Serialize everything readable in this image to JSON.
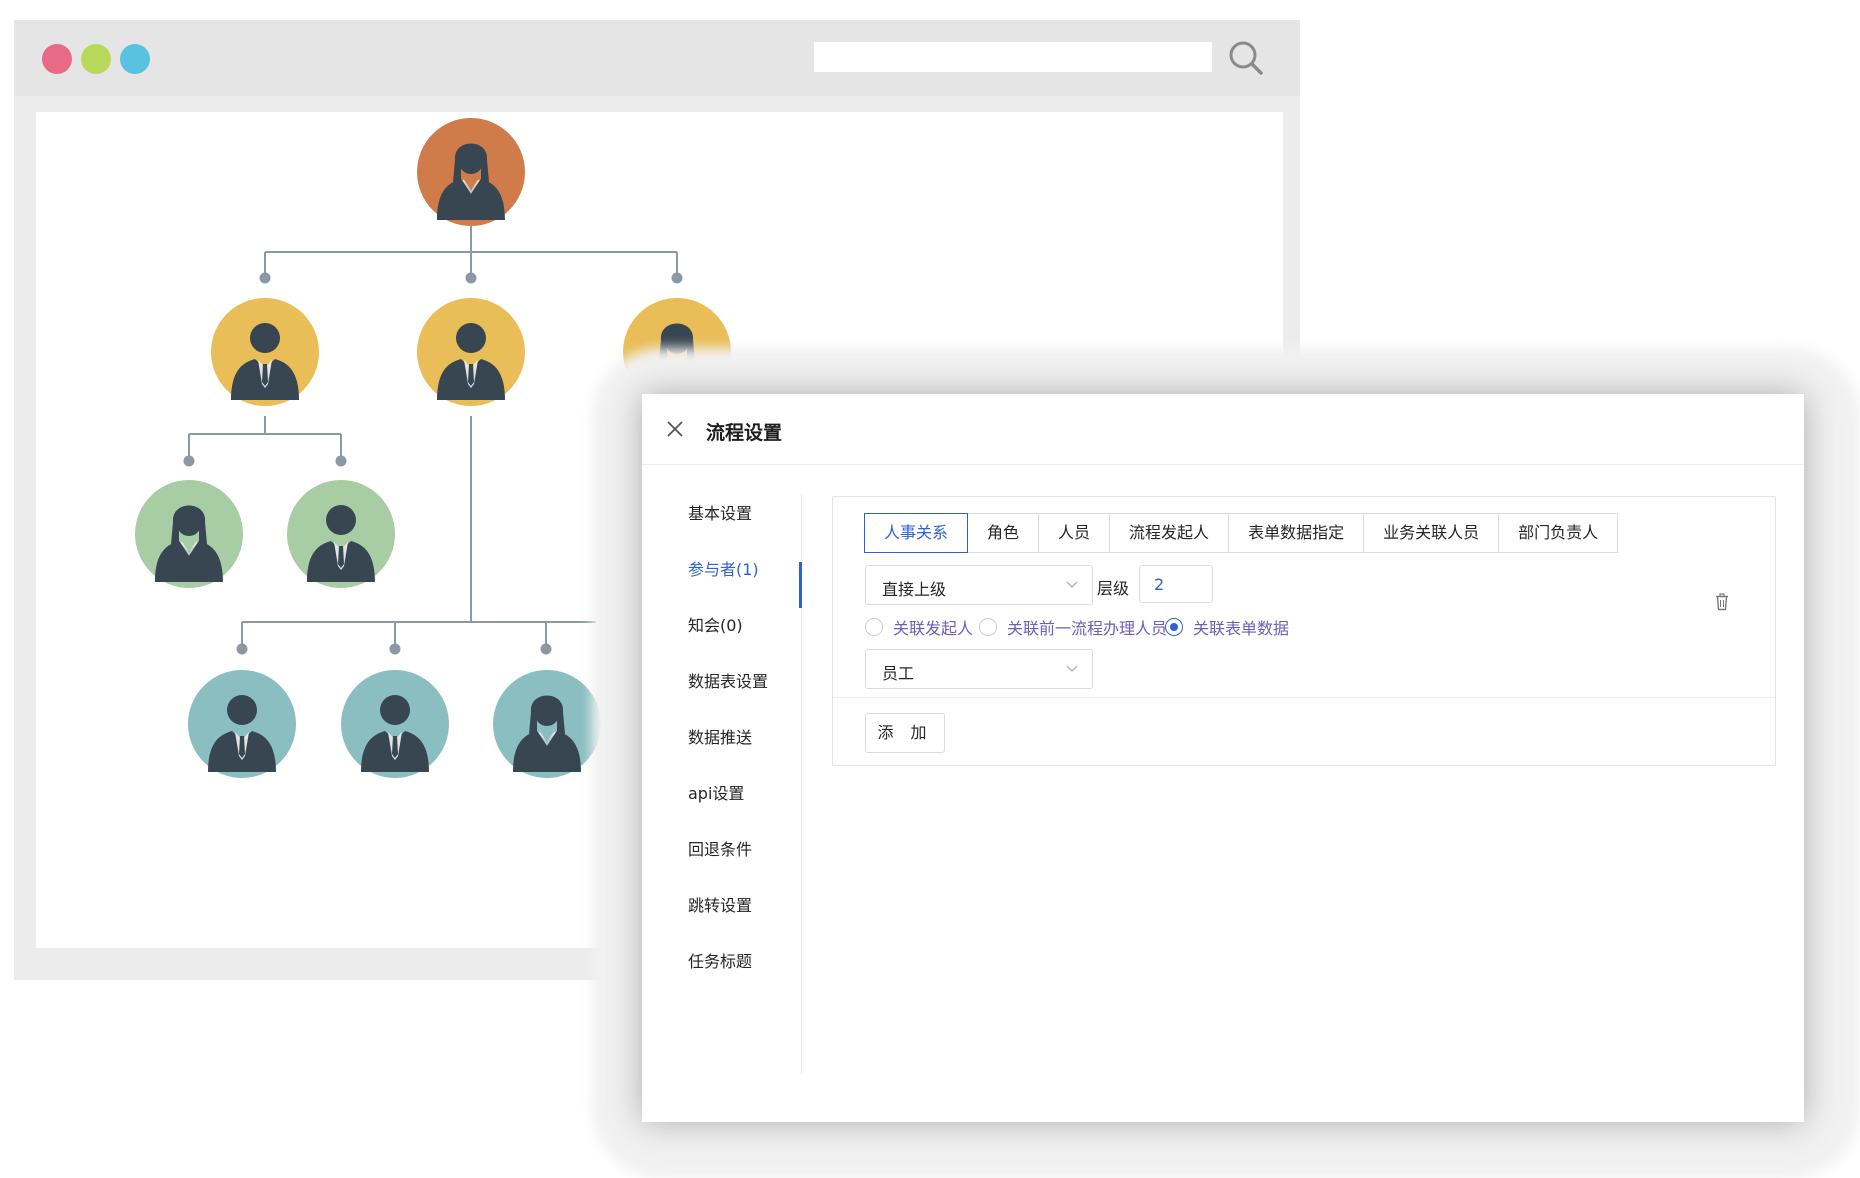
{
  "dialog": {
    "title": "流程设置"
  },
  "side_nav": {
    "items": [
      {
        "label": "基本设置"
      },
      {
        "label": "参与者(1)",
        "active": true
      },
      {
        "label": "知会(0)"
      },
      {
        "label": "数据表设置"
      },
      {
        "label": "数据推送"
      },
      {
        "label": "api设置"
      },
      {
        "label": "回退条件"
      },
      {
        "label": "跳转设置"
      },
      {
        "label": "任务标题"
      }
    ]
  },
  "tabs": [
    {
      "label": "人事关系",
      "active": true
    },
    {
      "label": "角色"
    },
    {
      "label": "人员"
    },
    {
      "label": "流程发起人"
    },
    {
      "label": "表单数据指定"
    },
    {
      "label": "业务关联人员"
    },
    {
      "label": "部门负责人"
    }
  ],
  "form": {
    "relation_select": "直接上级",
    "level_label": "层级",
    "level_value": "2",
    "radios": [
      {
        "label": "关联发起人",
        "checked": false
      },
      {
        "label": "关联前一流程办理人员",
        "checked": false
      },
      {
        "label": "关联表单数据",
        "checked": true
      }
    ],
    "field_select": "员工",
    "add_button": "添 加"
  },
  "colors": {
    "accent": "#2f61d6",
    "radio_label": "#6e5fb8",
    "org_top": "#cf7c4a",
    "org_level2": "#e9bd57",
    "org_level3": "#a8cca4",
    "org_level4": "#8bbec1",
    "avatar_dark": "#374651",
    "browser_red": "#e96a86",
    "browser_green": "#b8d85a",
    "browser_blue": "#57c3e1"
  },
  "icons": [
    "search-icon",
    "close-icon",
    "chevron-down-icon",
    "trash-icon",
    "person-icon"
  ]
}
